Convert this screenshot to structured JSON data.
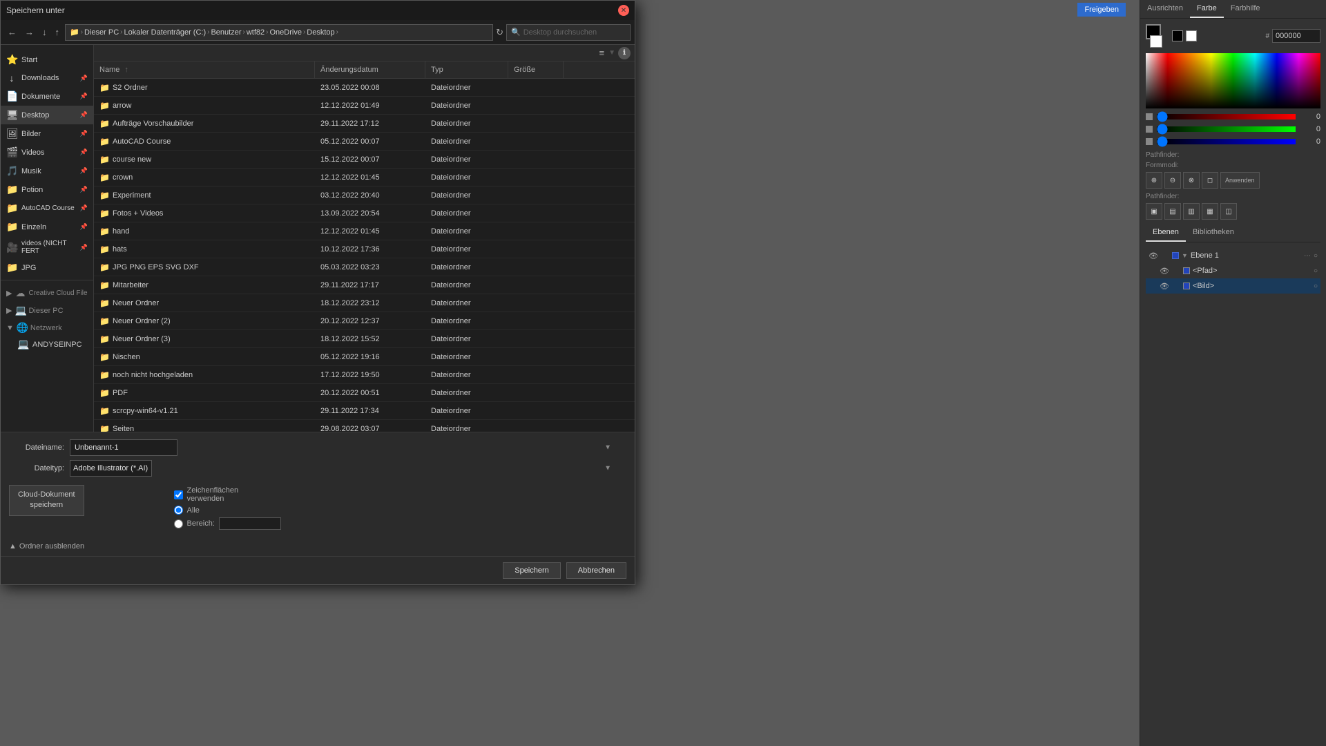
{
  "dialog": {
    "title": "Speichern unter",
    "addressbar": {
      "breadcrumbs": [
        "Dieser PC",
        "Lokaler Datenträger (C:)",
        "Benutzer",
        "wtf82",
        "OneDrive",
        "Desktop"
      ],
      "search_placeholder": "Desktop durchsuchen"
    },
    "nav_buttons": [
      "←",
      "→",
      "↓",
      "↑"
    ],
    "toolbar": {
      "view_label": "≡",
      "info_label": "ℹ"
    },
    "columns": {
      "name": "Name",
      "date": "Änderungsdatum",
      "type": "Typ",
      "size": "Größe"
    },
    "files": [
      {
        "name": "S2 Ordner",
        "date": "23.05.2022 00:08",
        "type": "Dateiordner",
        "size": ""
      },
      {
        "name": "arrow",
        "date": "12.12.2022 01:49",
        "type": "Dateiordner",
        "size": ""
      },
      {
        "name": "Aufträge Vorschaubilder",
        "date": "29.11.2022 17:12",
        "type": "Dateiordner",
        "size": ""
      },
      {
        "name": "AutoCAD Course",
        "date": "05.12.2022 00:07",
        "type": "Dateiordner",
        "size": ""
      },
      {
        "name": "course new",
        "date": "15.12.2022 00:07",
        "type": "Dateiordner",
        "size": ""
      },
      {
        "name": "crown",
        "date": "12.12.2022 01:45",
        "type": "Dateiordner",
        "size": ""
      },
      {
        "name": "Experiment",
        "date": "03.12.2022 20:40",
        "type": "Dateiordner",
        "size": ""
      },
      {
        "name": "Fotos + Videos",
        "date": "13.09.2022 20:54",
        "type": "Dateiordner",
        "size": ""
      },
      {
        "name": "hand",
        "date": "12.12.2022 01:45",
        "type": "Dateiordner",
        "size": ""
      },
      {
        "name": "hats",
        "date": "10.12.2022 17:36",
        "type": "Dateiordner",
        "size": ""
      },
      {
        "name": "JPG PNG EPS SVG DXF",
        "date": "05.03.2022 03:23",
        "type": "Dateiordner",
        "size": ""
      },
      {
        "name": "Mitarbeiter",
        "date": "29.11.2022 17:17",
        "type": "Dateiordner",
        "size": ""
      },
      {
        "name": "Neuer Ordner",
        "date": "18.12.2022 23:12",
        "type": "Dateiordner",
        "size": ""
      },
      {
        "name": "Neuer Ordner (2)",
        "date": "20.12.2022 12:37",
        "type": "Dateiordner",
        "size": ""
      },
      {
        "name": "Neuer Ordner (3)",
        "date": "18.12.2022 15:52",
        "type": "Dateiordner",
        "size": ""
      },
      {
        "name": "Nischen",
        "date": "05.12.2022 19:16",
        "type": "Dateiordner",
        "size": ""
      },
      {
        "name": "noch nicht hochgeladen",
        "date": "17.12.2022 19:50",
        "type": "Dateiordner",
        "size": ""
      },
      {
        "name": "PDF",
        "date": "20.12.2022 00:51",
        "type": "Dateiordner",
        "size": ""
      },
      {
        "name": "scrcpy-win64-v1.21",
        "date": "29.11.2022 17:34",
        "type": "Dateiordner",
        "size": ""
      },
      {
        "name": "Seiten",
        "date": "29.08.2022 03:07",
        "type": "Dateiordner",
        "size": ""
      }
    ],
    "filename_label": "Dateiname:",
    "filename_value": "Unbenannt-1",
    "filetype_label": "Dateityp:",
    "filetype_value": "Adobe Illustrator (*.AI)",
    "cloud_save_label": "Cloud-Dokument\nspeichern",
    "checkbox_label": "Zeichenflächen\nverwenden",
    "radio_all": "Alle",
    "radio_range": "Bereich:",
    "folder_toggle_label": "Ordner ausblenden",
    "buttons": {
      "save": "Speichern",
      "cancel": "Abbrechen"
    }
  },
  "sidebar": {
    "items": [
      {
        "icon": "⭐",
        "label": "Start",
        "pinned": false
      },
      {
        "icon": "↓",
        "label": "Downloads",
        "pinned": true
      },
      {
        "icon": "📄",
        "label": "Dokumente",
        "pinned": true
      },
      {
        "icon": "🖥",
        "label": "Desktop",
        "pinned": true
      },
      {
        "icon": "🖼",
        "label": "Bilder",
        "pinned": true
      },
      {
        "icon": "🎬",
        "label": "Videos",
        "pinned": true
      },
      {
        "icon": "🎵",
        "label": "Musik",
        "pinned": true
      },
      {
        "icon": "🧪",
        "label": "Potion",
        "pinned": true
      },
      {
        "icon": "📐",
        "label": "AutoCAD Course",
        "pinned": true
      },
      {
        "icon": "📁",
        "label": "Einzeln",
        "pinned": true
      },
      {
        "icon": "🎥",
        "label": "videos (NICHT FERT",
        "pinned": true
      },
      {
        "icon": "📁",
        "label": "JPG",
        "pinned": true
      }
    ],
    "sections": [
      {
        "label": "Creative Cloud Files",
        "expanded": false
      },
      {
        "label": "Dieser PC",
        "expanded": false
      },
      {
        "label": "Netzwerk",
        "expanded": true
      },
      {
        "label": "ANDYSEINPC",
        "expanded": false
      }
    ]
  },
  "right_panel": {
    "tabs": [
      "Ausrichten",
      "Farbe",
      "Farbhilfe"
    ],
    "active_tab": "Farbe",
    "color": {
      "r": 0,
      "g": 0,
      "b": 0,
      "hex": "000000"
    },
    "pathfinder_label": "Pathfinder:",
    "formmode_label": "Formmodi:",
    "pathfinder_section": "Pathfinder:",
    "layers_tabs": [
      "Ebenen",
      "Bibliotheken"
    ],
    "layers": [
      {
        "name": "Ebene 1",
        "visible": true,
        "locked": false,
        "color": "#2244bb"
      },
      {
        "name": "<Pfad>",
        "visible": true,
        "locked": false,
        "color": "#2244bb",
        "sub": true
      },
      {
        "name": "<Bild>",
        "visible": true,
        "locked": false,
        "color": "#2244bb",
        "sub": true
      }
    ]
  },
  "freigeben": "Freigeben"
}
